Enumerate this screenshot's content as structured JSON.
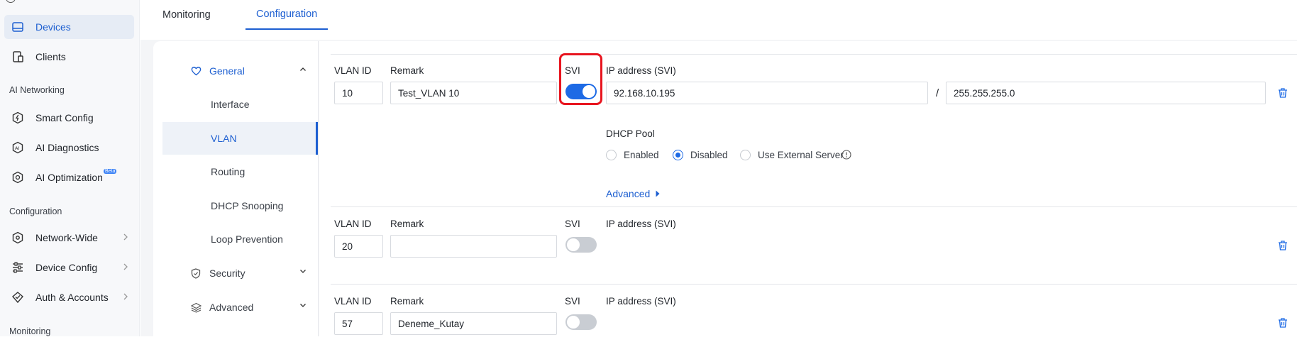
{
  "nav": {
    "items": [
      {
        "label": "Devices"
      },
      {
        "label": "Clients"
      },
      {
        "label": "Smart Config"
      },
      {
        "label": "AI Diagnostics"
      },
      {
        "label": "AI Optimization",
        "badge": "Beta"
      },
      {
        "label": "Network-Wide"
      },
      {
        "label": "Device Config"
      },
      {
        "label": "Auth & Accounts"
      }
    ],
    "sections": [
      "AI Networking",
      "Configuration",
      "Monitoring"
    ]
  },
  "tabs": [
    {
      "label": "Monitoring"
    },
    {
      "label": "Configuration"
    }
  ],
  "subnav": {
    "general": "General",
    "children": [
      "Interface",
      "VLAN",
      "Routing",
      "DHCP Snooping",
      "Loop Prevention"
    ],
    "security": "Security",
    "advanced": "Advanced"
  },
  "labels": {
    "vlan_id": "VLAN ID",
    "remark": "Remark",
    "svi": "SVI",
    "ip_svi": "IP address (SVI)",
    "slash": "/",
    "dhcp_pool": "DHCP Pool",
    "enabled": "Enabled",
    "disabled": "Disabled",
    "external": "Use External Server",
    "advanced_link": "Advanced"
  },
  "vlans": [
    {
      "id": "10",
      "remark": "Test_VLAN 10",
      "svi": true,
      "ip": "92.168.10.195",
      "mask": "255.255.255.0",
      "dhcp": "Disabled"
    },
    {
      "id": "20",
      "remark": "",
      "svi": false
    },
    {
      "id": "57",
      "remark": "Deneme_Kutay",
      "svi": false
    }
  ],
  "colors": {
    "accent": "#1d6ae5",
    "highlight": "#e8151f"
  },
  "icons": [
    "devices-icon",
    "clients-icon",
    "smart-config-icon",
    "ai-diagnostics-icon",
    "ai-optimization-icon",
    "network-wide-icon",
    "device-config-icon",
    "auth-accounts-icon",
    "heart-icon",
    "shield-icon",
    "layers-icon",
    "trash-icon",
    "info-icon",
    "caret-right-icon"
  ]
}
